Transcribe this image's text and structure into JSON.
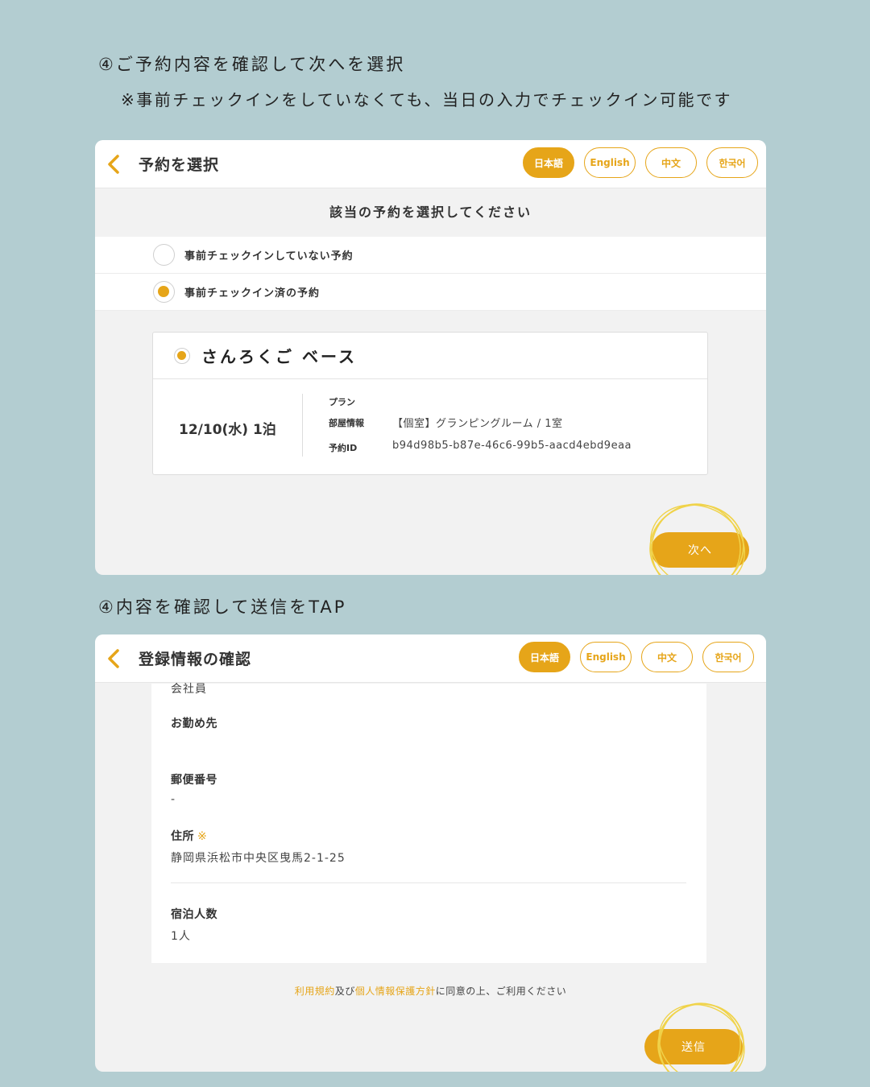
{
  "captions": {
    "step1": "④ご予約内容を確認して次へを選択",
    "step1_note": "※事前チェックインをしていなくても、当日の入力でチェックイン可能です",
    "step2": "④内容を確認して送信をTAP"
  },
  "languages": [
    "日本語",
    "English",
    "中文",
    "한국어"
  ],
  "colors": {
    "accent": "#e6a519",
    "background": "#b3cdd1",
    "panel": "#f2f2f2"
  },
  "screen1": {
    "title": "予約を選択",
    "subtitle": "該当の予約を選択してください",
    "options": [
      "事前チェックインしていない予約",
      "事前チェックイン済の予約"
    ],
    "selected_option": 1,
    "reservation": {
      "facility": "さんろくご ベース",
      "date": "12/10(水)  1泊",
      "plan_label": "プラン",
      "plan_value": "",
      "room_label": "部屋情報",
      "room_value": "【個室】グランピングルーム / 1室",
      "id_label": "予約ID",
      "id_value": "b94d98b5-b87e-46c6-99b5-aacd4ebd9eaa"
    },
    "next_button": "次へ"
  },
  "screen2": {
    "title": "登録情報の確認",
    "partial_value": "会社員",
    "fields": {
      "workplace_label": "お勤め先",
      "workplace_value": "",
      "postal_label": "郵便番号",
      "postal_value": "-",
      "address_label": "住所",
      "address_required": "※",
      "address_value": "静岡県浜松市中央区曳馬2-1-25",
      "guests_label": "宿泊人数",
      "guests_value": "1人"
    },
    "terms": {
      "link1": "利用規約",
      "and": "及び",
      "link2": "個人情報保護方針",
      "rest": "に同意の上、ご利用ください"
    },
    "send_button": "送信"
  }
}
